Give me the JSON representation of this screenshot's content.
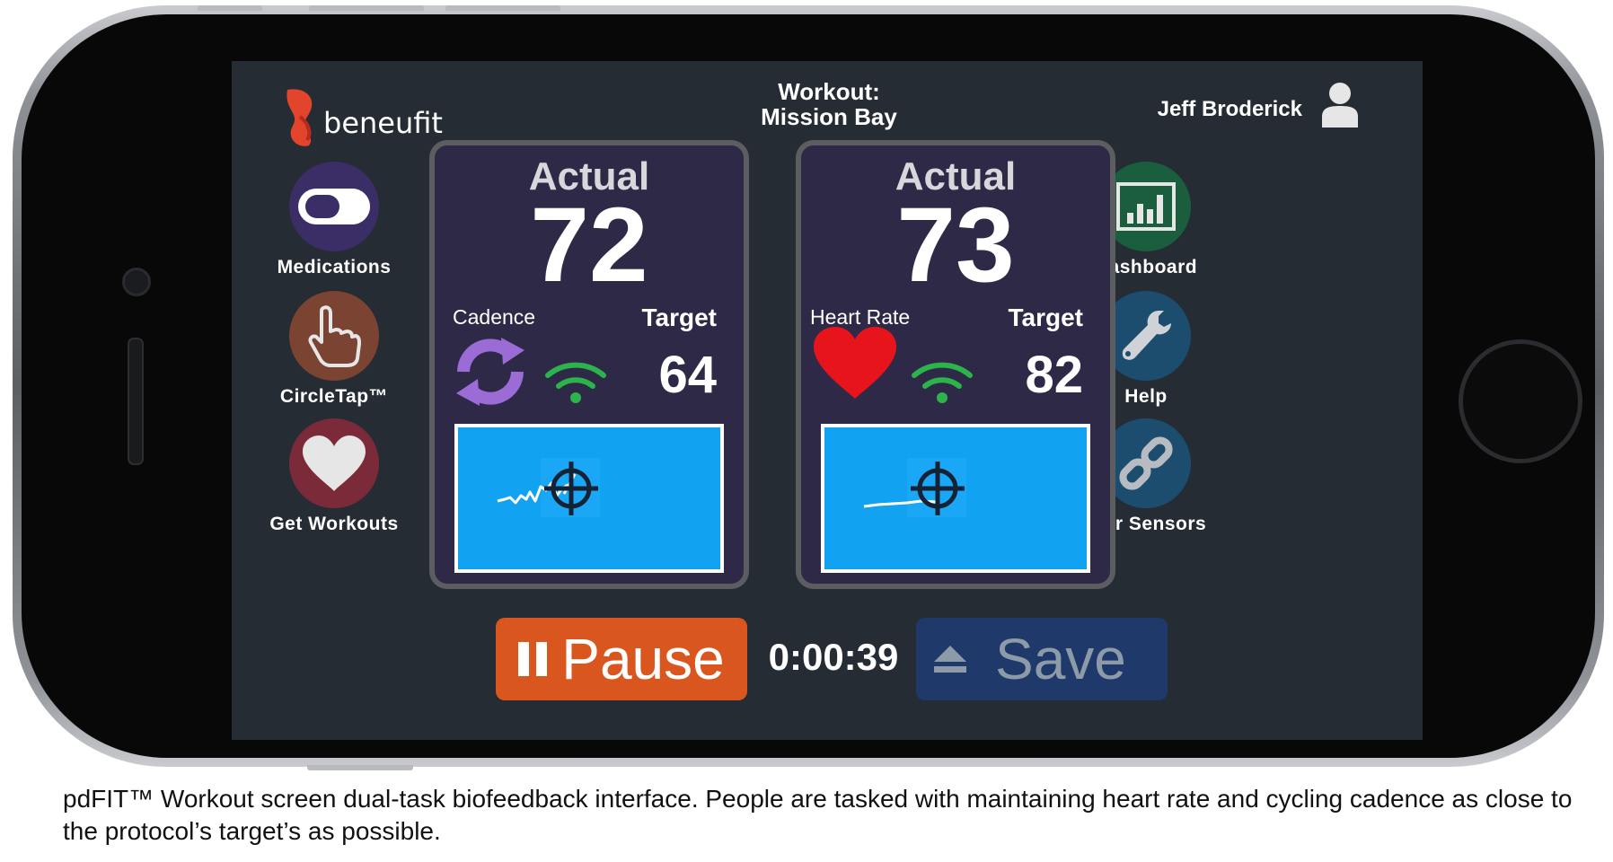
{
  "app": {
    "brand": "beneufit",
    "workout_title_line1": "Workout:",
    "workout_title_line2": "Mission Bay",
    "user_name": "Jeff Broderick"
  },
  "left_nav": [
    {
      "label": "Medications",
      "icon": "pill-icon",
      "color": "#3b2d66"
    },
    {
      "label": "CircleTap™",
      "icon": "hand-pointer-icon",
      "color": "#7a4332"
    },
    {
      "label": "Get Workouts",
      "icon": "heart-icon",
      "color": "#7a2a38"
    }
  ],
  "right_nav": [
    {
      "label": "Dashboard",
      "icon": "bar-chart-icon",
      "color": "#1b5e3e"
    },
    {
      "label": "Help",
      "icon": "wrench-icon",
      "color": "#1c4d6e"
    },
    {
      "label": "Pair Sensors",
      "icon": "link-icon",
      "color": "#1c4d6e"
    }
  ],
  "panels": [
    {
      "actual_label": "Actual",
      "actual_value": "72",
      "metric": "Cadence",
      "target_label": "Target",
      "target_value": "64",
      "icon": "sync-icon"
    },
    {
      "actual_label": "Actual",
      "actual_value": "73",
      "metric": "Heart Rate",
      "target_label": "Target",
      "target_value": "82",
      "icon": "heart-icon"
    }
  ],
  "controls": {
    "pause_label": "Pause",
    "timer": "0:00:39",
    "save_label": "Save"
  },
  "caption": "pdFIT™ Workout screen dual-task biofeedback interface. People are tasked with maintaining heart rate and cycling cadence as close to the protocol’s target’s as possible.",
  "colors": {
    "screen_bg": "#252c34",
    "panel_bg": "#2f2948",
    "graph_bg": "#12a2f2",
    "pause": "#d9561f",
    "save": "#1f3a6a",
    "wifi": "#2cb34a",
    "sync": "#9b6bd6",
    "heart": "#e8141b"
  }
}
